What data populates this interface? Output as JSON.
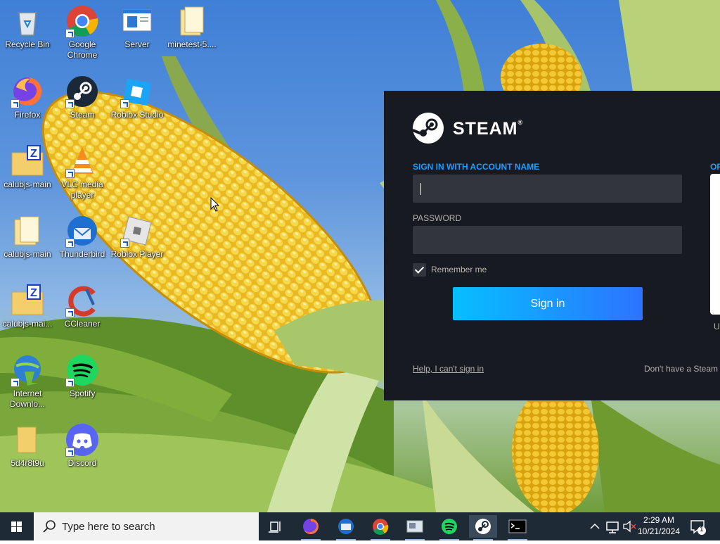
{
  "desktop": {
    "icons": [
      {
        "label": "Recycle Bin",
        "icon": "recycle-bin-icon"
      },
      {
        "label": "Google Chrome",
        "icon": "chrome-icon"
      },
      {
        "label": "Server",
        "icon": "server-window-icon"
      },
      {
        "label": "minetest-5....",
        "icon": "folder-icon"
      },
      {
        "label": "Firefox",
        "icon": "firefox-icon"
      },
      {
        "label": "Steam",
        "icon": "steam-icon"
      },
      {
        "label": "Roblox Studio",
        "icon": "roblox-studio-icon"
      },
      {
        "label": "calubjs-main",
        "icon": "zip-folder-icon"
      },
      {
        "label": "VLC media player",
        "icon": "vlc-icon"
      },
      {
        "label": "calubjs-main",
        "icon": "folder-icon"
      },
      {
        "label": "Thunderbird",
        "icon": "thunderbird-icon"
      },
      {
        "label": "Roblox Player",
        "icon": "roblox-icon"
      },
      {
        "label": "calubjs-mai...",
        "icon": "zip-folder-icon"
      },
      {
        "label": "CCleaner",
        "icon": "ccleaner-icon"
      },
      {
        "label": "Internet Downlo...",
        "icon": "idm-icon"
      },
      {
        "label": "Spotify",
        "icon": "spotify-icon"
      },
      {
        "label": "5d4r8t9u",
        "icon": "folder-icon"
      },
      {
        "label": "Discord",
        "icon": "discord-icon"
      }
    ]
  },
  "steam": {
    "brand": "STEAM",
    "tm": "®",
    "account_label": "SIGN IN WITH ACCOUNT NAME",
    "qr_label": "OR",
    "password_label": "PASSWORD",
    "remember_label": "Remember me",
    "remember_checked": true,
    "signin_label": "Sign in",
    "help_link": "Help, I can't sign in",
    "no_account": "Don't have a Steam",
    "qr_caption": "U",
    "colors": {
      "bg": "#181a21",
      "accent": "#1a9fff",
      "field": "#32353c"
    }
  },
  "taskbar": {
    "search_placeholder": "Type here to search",
    "apps": [
      "task-view-icon",
      "firefox-icon",
      "thunderbird-icon",
      "chrome-icon",
      "file-explorer-icon",
      "spotify-icon",
      "steam-icon",
      "terminal-icon"
    ],
    "time": "2:29 AM",
    "date": "10/21/2024",
    "notification_count": "1"
  }
}
